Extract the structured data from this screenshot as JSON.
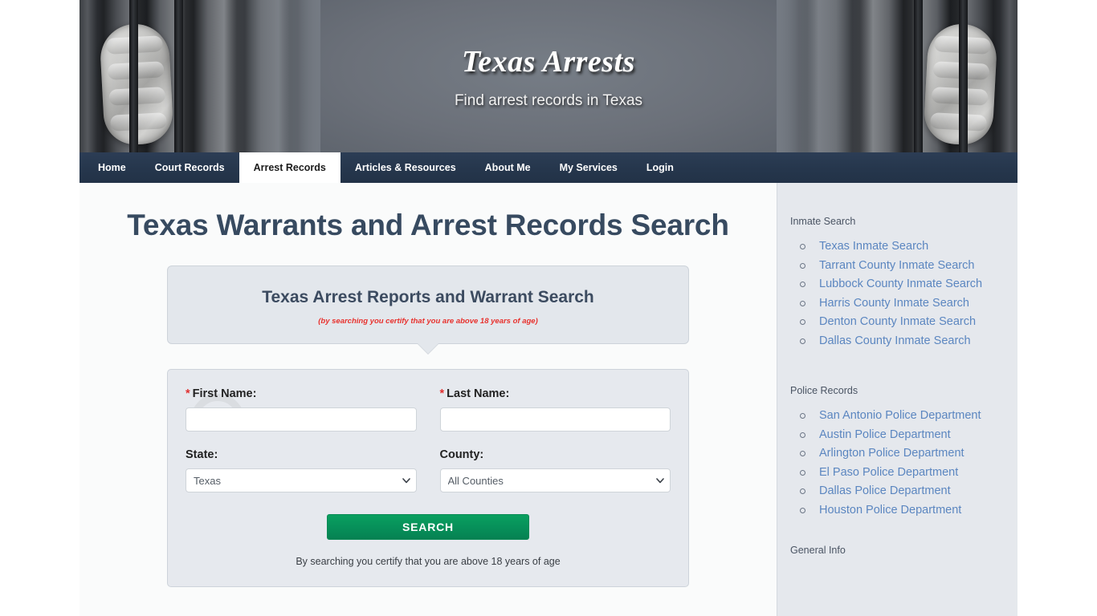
{
  "header": {
    "title": "Texas Arrests",
    "subtitle": "Find arrest records in Texas"
  },
  "nav": {
    "items": [
      {
        "label": "Home",
        "active": false
      },
      {
        "label": "Court Records",
        "active": false
      },
      {
        "label": "Arrest Records",
        "active": true
      },
      {
        "label": "Articles & Resources",
        "active": false
      },
      {
        "label": "About Me",
        "active": false
      },
      {
        "label": "My Services",
        "active": false
      },
      {
        "label": "Login",
        "active": false
      }
    ]
  },
  "main": {
    "page_title": "Texas Warrants and Arrest Records Search",
    "bubble": {
      "heading": "Texas Arrest Reports and Warrant Search",
      "disclaimer": "(by searching you certify that you are above 18 years of age)"
    },
    "form": {
      "first_name": {
        "label": "First Name:",
        "required_mark": "*",
        "value": "",
        "placeholder": ""
      },
      "last_name": {
        "label": "Last Name:",
        "required_mark": "*",
        "value": "",
        "placeholder": ""
      },
      "state": {
        "label": "State:",
        "selected": "Texas",
        "options": [
          "Texas"
        ]
      },
      "county": {
        "label": "County:",
        "selected": "All Counties",
        "options": [
          "All Counties"
        ]
      },
      "submit_label": "SEARCH",
      "certify_text": "By searching you certify that you are above 18 years of age"
    }
  },
  "sidebar": {
    "sections": [
      {
        "heading": "Inmate Search",
        "links": [
          "Texas Inmate Search",
          "Tarrant County Inmate Search",
          "Lubbock County Inmate Search",
          "Harris County Inmate Search",
          "Denton County Inmate Search",
          "Dallas County Inmate Search"
        ]
      },
      {
        "heading": "Police Records",
        "links": [
          "San Antonio Police Department",
          "Austin Police Department",
          "Arlington Police Department",
          "El Paso Police Department",
          "Dallas Police Department",
          "Houston Police Department"
        ]
      },
      {
        "heading": "General Info",
        "links": []
      }
    ]
  },
  "colors": {
    "nav_bg": "#26374d",
    "title_text": "#374a60",
    "link_blue": "#5b86c0",
    "button_green": "#07915a",
    "disclaimer_red": "#e8322e",
    "sidebar_bg": "#e5e8ed"
  },
  "icons": {
    "chevron_down": "chevron-down-icon",
    "bullet": "circle-bullet-icon"
  }
}
